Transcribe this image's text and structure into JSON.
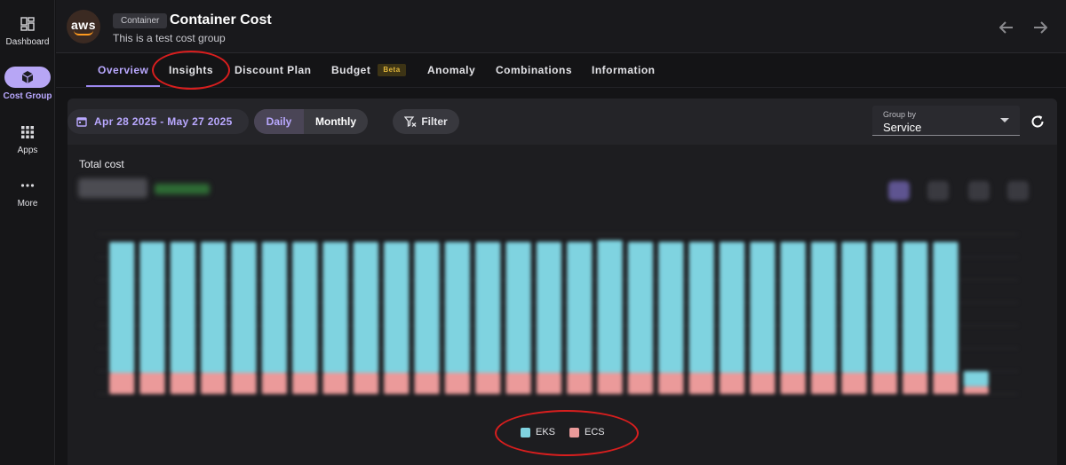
{
  "sidebar": {
    "items": [
      {
        "label": "Dashboard",
        "icon": "dashboard-icon"
      },
      {
        "label": "Cost Group",
        "icon": "cube-icon",
        "active": true
      },
      {
        "label": "Apps",
        "icon": "apps-grid-icon"
      },
      {
        "label": "More",
        "icon": "more-dots-icon"
      }
    ]
  },
  "header": {
    "logo_text": "aws",
    "badge": "Container",
    "title": "Container Cost",
    "subtitle": "This is a test cost group"
  },
  "tabs": [
    {
      "label": "Overview",
      "active": true
    },
    {
      "label": "Insights"
    },
    {
      "label": "Discount Plan"
    },
    {
      "label": "Budget",
      "badge": "Beta"
    },
    {
      "label": "Anomaly"
    },
    {
      "label": "Combinations"
    },
    {
      "label": "Information"
    }
  ],
  "toolbar": {
    "date_range": "Apr 28 2025 - May 27 2025",
    "granularity_options": [
      "Daily",
      "Monthly"
    ],
    "granularity_selected": "Daily",
    "filter_label": "Filter",
    "group_by_label": "Group by",
    "group_by_value": "Service"
  },
  "summary": {
    "total_label": "Total cost"
  },
  "colors": {
    "accent": "#b9a8ff",
    "eks": "#7fd3e0",
    "ecs": "#eb9a9a",
    "annotation": "#d81e1e"
  },
  "chart_data": {
    "type": "bar",
    "stacked": true,
    "series": [
      {
        "name": "EKS",
        "values": [
          0.86,
          0.86,
          0.86,
          0.86,
          0.86,
          0.86,
          0.86,
          0.86,
          0.86,
          0.86,
          0.86,
          0.86,
          0.86,
          0.86,
          0.86,
          0.86,
          0.87,
          0.86,
          0.86,
          0.86,
          0.86,
          0.86,
          0.86,
          0.86,
          0.86,
          0.86,
          0.86,
          0.86,
          0.1
        ]
      },
      {
        "name": "ECS",
        "values": [
          0.14,
          0.14,
          0.14,
          0.14,
          0.14,
          0.14,
          0.14,
          0.14,
          0.14,
          0.14,
          0.14,
          0.14,
          0.14,
          0.14,
          0.14,
          0.14,
          0.14,
          0.14,
          0.14,
          0.14,
          0.14,
          0.14,
          0.14,
          0.14,
          0.14,
          0.14,
          0.14,
          0.14,
          0.05
        ]
      }
    ],
    "ylim": [
      0,
      1.05
    ],
    "legend": "bottom-center",
    "values_obscured": true
  }
}
